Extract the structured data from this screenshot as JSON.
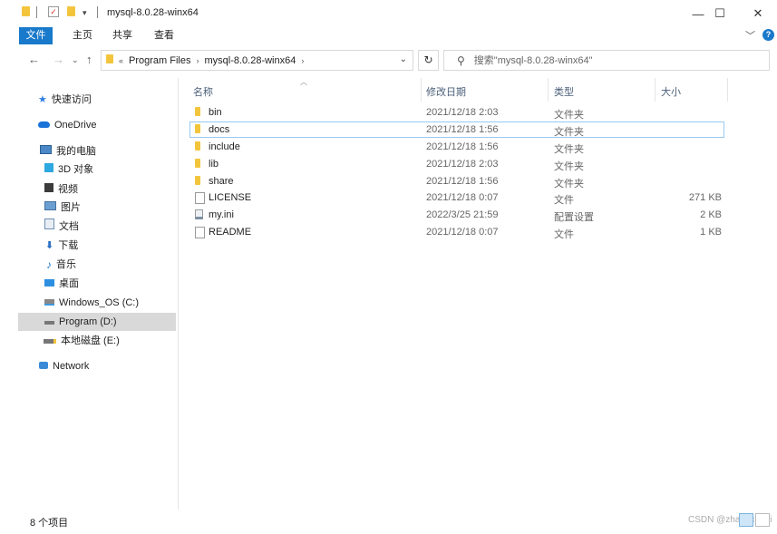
{
  "window": {
    "title": "mysql-8.0.28-winx64",
    "minimize": "—",
    "maximize": "☐",
    "close": "✕"
  },
  "ribbon": {
    "tabs": [
      {
        "label": "文件",
        "active": true
      },
      {
        "label": "主页"
      },
      {
        "label": "共享"
      },
      {
        "label": "查看"
      }
    ],
    "expand": "﹀",
    "help": "?"
  },
  "address": {
    "crumbs": [
      "Program Files",
      "mysql-8.0.28-winx64"
    ],
    "prefix": "«"
  },
  "search": {
    "placeholder": "搜索\"mysql-8.0.28-winx64\""
  },
  "nav": {
    "items": [
      {
        "label": "快速访问",
        "icon": "star-icon"
      },
      {
        "label": "OneDrive",
        "icon": "cloud-icon"
      },
      {
        "label": "我的电脑",
        "icon": "computer-icon"
      },
      {
        "label": "3D 对象",
        "icon": "cube-icon"
      },
      {
        "label": "视频",
        "icon": "video-icon"
      },
      {
        "label": "图片",
        "icon": "picture-icon"
      },
      {
        "label": "文档",
        "icon": "document-icon"
      },
      {
        "label": "下载",
        "icon": "download-icon"
      },
      {
        "label": "音乐",
        "icon": "music-icon"
      },
      {
        "label": "桌面",
        "icon": "desktop-icon"
      },
      {
        "label": "Windows_OS (C:)",
        "icon": "drive-icon"
      },
      {
        "label": "Program (D:)",
        "icon": "drive-icon",
        "selected": true
      },
      {
        "label": "本地磁盘 (E:)",
        "icon": "drive-icon"
      },
      {
        "label": "Network",
        "icon": "network-icon"
      }
    ]
  },
  "columns": [
    "名称",
    "修改日期",
    "类型",
    "大小"
  ],
  "files": [
    {
      "name": "bin",
      "date": "2021/12/18 2:03",
      "type": "文件夹",
      "size": "",
      "icon": "folder-icon"
    },
    {
      "name": "docs",
      "date": "2021/12/18 1:56",
      "type": "文件夹",
      "size": "",
      "icon": "folder-icon",
      "focused": true
    },
    {
      "name": "include",
      "date": "2021/12/18 1:56",
      "type": "文件夹",
      "size": "",
      "icon": "folder-icon"
    },
    {
      "name": "lib",
      "date": "2021/12/18 2:03",
      "type": "文件夹",
      "size": "",
      "icon": "folder-icon"
    },
    {
      "name": "share",
      "date": "2021/12/18 1:56",
      "type": "文件夹",
      "size": "",
      "icon": "folder-icon"
    },
    {
      "name": "LICENSE",
      "date": "2021/12/18 0:07",
      "type": "文件",
      "size": "271 KB",
      "icon": "file-icon"
    },
    {
      "name": "my.ini",
      "date": "2022/3/25 21:59",
      "type": "配置设置",
      "size": "2 KB",
      "icon": "config-file-icon"
    },
    {
      "name": "README",
      "date": "2021/12/18 0:07",
      "type": "文件",
      "size": "1 KB",
      "icon": "file-icon"
    }
  ],
  "status": {
    "count": "8 个项目",
    "watermark": "CSDN @zhangchuni"
  },
  "colors": {
    "accent": "#1979ca",
    "folder": "#f3c53c",
    "selected_nav": "#d9d9d9",
    "focus_border": "#99c9ef"
  }
}
